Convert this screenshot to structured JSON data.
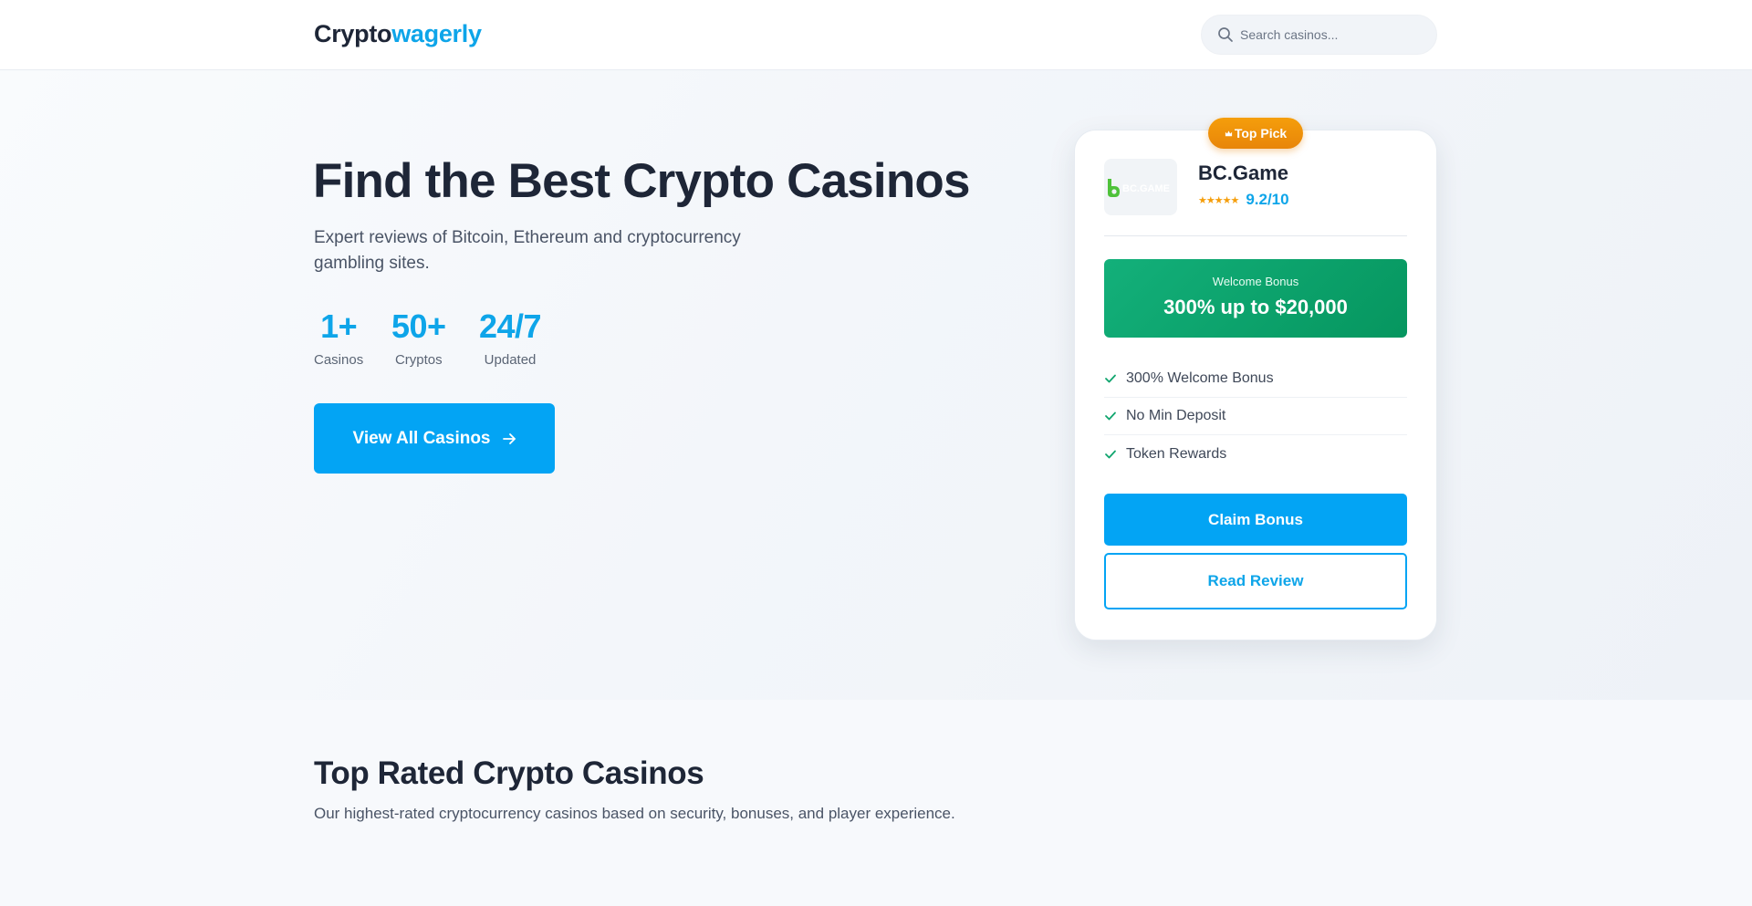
{
  "header": {
    "logo_part1": "Crypto",
    "logo_part2": "wagerly",
    "search_placeholder": "Search casinos..."
  },
  "hero": {
    "title": "Find the Best Crypto Casinos",
    "subtitle": "Expert reviews of Bitcoin, Ethereum and cryptocurrency gambling sites.",
    "stats": [
      {
        "value": "1+",
        "label": "Casinos"
      },
      {
        "value": "50+",
        "label": "Cryptos"
      },
      {
        "value": "24/7",
        "label": "Updated"
      }
    ],
    "cta_label": "View All Casinos"
  },
  "top_pick": {
    "badge": "Top Pick",
    "badge_icon": "crown-icon",
    "casino_name": "BC.Game",
    "logo_text": "BC.GAME",
    "stars": "★★★★★",
    "rating": "9.2/10",
    "bonus_label": "Welcome Bonus",
    "bonus_value": "300% up to $20,000",
    "features": [
      "300% Welcome Bonus",
      "No Min Deposit",
      "Token Rewards"
    ],
    "claim_label": "Claim Bonus",
    "review_label": "Read Review"
  },
  "section": {
    "title": "Top Rated Crypto Casinos",
    "subtitle": "Our highest-rated cryptocurrency casinos based on security, bonuses, and player experience."
  },
  "colors": {
    "accent": "#0ea5e9",
    "button": "#03a4f4",
    "bonus_green": "#0c9f6a",
    "badge_orange": "#f59e0b"
  }
}
